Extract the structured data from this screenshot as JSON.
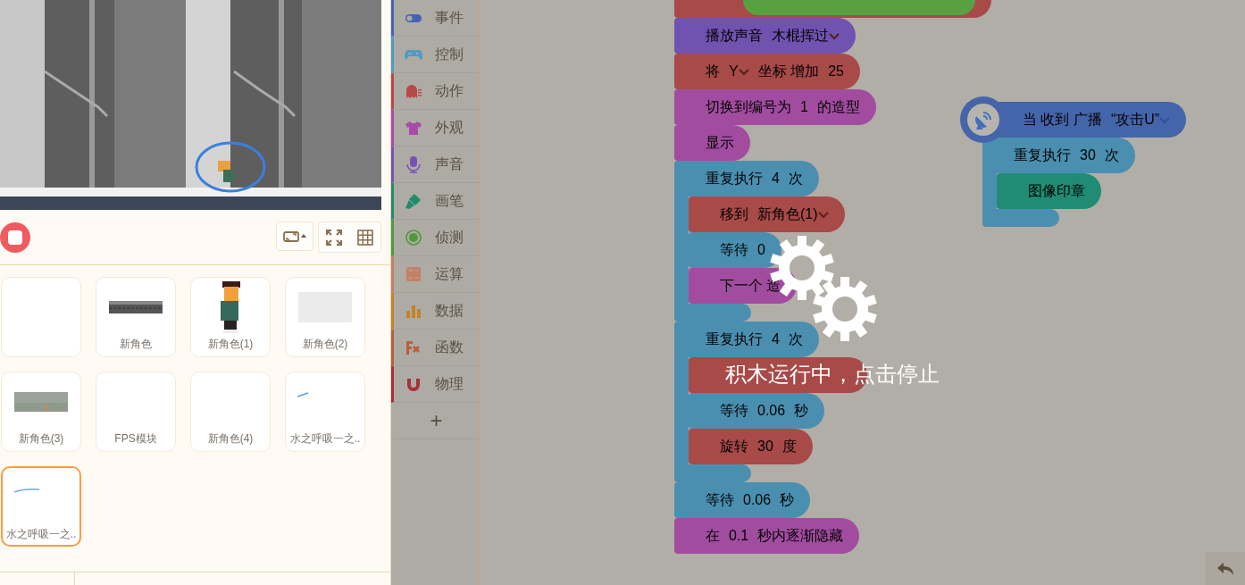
{
  "sprites": [
    {
      "kind": "empty",
      "selected": false
    },
    {
      "kind": "strip",
      "name": "新角色",
      "selected": false
    },
    {
      "kind": "figure",
      "name": "新角色(1)",
      "selected": false
    },
    {
      "kind": "faint",
      "name": "新角色(2)",
      "selected": false
    },
    {
      "kind": "scene",
      "name": "新角色(3)",
      "selected": false
    },
    {
      "kind": "empty",
      "name": "FPS模块",
      "selected": false
    },
    {
      "kind": "empty",
      "name": "新角色(4)",
      "selected": false
    },
    {
      "kind": "stroke",
      "name": "水之呼吸一之..",
      "selected": false
    },
    {
      "kind": "stroke_long",
      "name": "水之呼吸一之..",
      "selected": true
    }
  ],
  "categories": [
    {
      "label": "事件",
      "color": "#4463b4"
    },
    {
      "label": "控制",
      "color": "#4d9dc4"
    },
    {
      "label": "动作",
      "color": "#b8474a"
    },
    {
      "label": "外观",
      "color": "#a84aaa"
    },
    {
      "label": "声音",
      "color": "#7652b8"
    },
    {
      "label": "画笔",
      "color": "#1f8c6e"
    },
    {
      "label": "侦测",
      "color": "#4f9a3c"
    },
    {
      "label": "运算",
      "color": "#c48066"
    },
    {
      "label": "数据",
      "color": "#c58328"
    },
    {
      "label": "函数",
      "color": "#b8603c"
    },
    {
      "label": "物理",
      "color": "#a8303a"
    }
  ],
  "add_category": {
    "label": "+"
  },
  "scripts": [
    {
      "blocks": [
        {
          "kind": "cut",
          "color": "#a84a48"
        },
        {
          "kind": "stack",
          "color": "#7052b0",
          "parts": [
            {
              "kind": "text",
              "text": "播放声音"
            },
            {
              "kind": "drop",
              "text": "木棍挥过"
            }
          ]
        },
        {
          "kind": "stack",
          "color": "#a84a48",
          "parts": [
            {
              "kind": "text",
              "text": "将"
            },
            {
              "kind": "drop",
              "text": "Y"
            },
            {
              "kind": "text",
              "text": "坐标 增加"
            },
            {
              "kind": "num",
              "text": "25"
            }
          ]
        },
        {
          "kind": "stack",
          "color": "#a24ca0",
          "parts": [
            {
              "kind": "text",
              "text": "切换到编号为"
            },
            {
              "kind": "num",
              "text": "1"
            },
            {
              "kind": "text",
              "text": "的造型"
            }
          ]
        },
        {
          "kind": "stack",
          "color": "#a24ca0",
          "parts": [
            {
              "kind": "text",
              "text": "显示"
            }
          ]
        },
        {
          "kind": "c",
          "color": "#4a8fb0",
          "parts": [
            {
              "kind": "text",
              "text": "重复执行"
            },
            {
              "kind": "num",
              "text": "4"
            },
            {
              "kind": "text",
              "text": "次"
            }
          ],
          "children": [
            {
              "kind": "stack",
              "color": "#a84a48",
              "parts": [
                {
                  "kind": "text",
                  "text": "移到"
                },
                {
                  "kind": "drop",
                  "text": "新角色(1)"
                }
              ]
            },
            {
              "kind": "stack",
              "color": "#4a8fb0",
              "parts": [
                {
                  "kind": "text",
                  "text": "等待"
                },
                {
                  "kind": "num",
                  "text": "0"
                }
              ]
            },
            {
              "kind": "stack",
              "color": "#a24ca0",
              "parts": [
                {
                  "kind": "text",
                  "text": "下一个 造"
                }
              ]
            }
          ]
        },
        {
          "kind": "c",
          "color": "#4a8fb0",
          "parts": [
            {
              "kind": "text",
              "text": "重复执行"
            },
            {
              "kind": "num",
              "text": "4"
            },
            {
              "kind": "text",
              "text": "次"
            }
          ],
          "children": [
            {
              "kind": "stack",
              "color": "#a84a48"
            },
            {
              "kind": "stack",
              "color": "#4a8fb0",
              "parts": [
                {
                  "kind": "text",
                  "text": "等待"
                },
                {
                  "kind": "num",
                  "text": "0.06"
                },
                {
                  "kind": "text",
                  "text": "秒"
                }
              ]
            },
            {
              "kind": "stack",
              "color": "#a84a48",
              "parts": [
                {
                  "kind": "text",
                  "text": "旋转"
                },
                {
                  "kind": "num",
                  "text": "30"
                },
                {
                  "kind": "text",
                  "text": "度"
                }
              ]
            }
          ]
        },
        {
          "kind": "stack",
          "color": "#4a8fb0",
          "parts": [
            {
              "kind": "text",
              "text": "等待"
            },
            {
              "kind": "num",
              "text": "0.06"
            },
            {
              "kind": "text",
              "text": "秒"
            }
          ]
        },
        {
          "kind": "stack",
          "color": "#a24ca0",
          "parts": [
            {
              "kind": "text",
              "text": "在"
            },
            {
              "kind": "num",
              "text": "0.1"
            },
            {
              "kind": "text",
              "text": "秒内逐渐隐藏"
            }
          ]
        }
      ]
    },
    {
      "blocks": [
        {
          "kind": "hat",
          "color": "#4565aa",
          "parts": [
            {
              "kind": "text",
              "text": "当 收到 广播"
            },
            {
              "kind": "broadcast",
              "text": "“攻击U”"
            }
          ]
        },
        {
          "kind": "c",
          "color": "#4a8fb0",
          "parts": [
            {
              "kind": "text",
              "text": "重复执行"
            },
            {
              "kind": "num",
              "text": "30"
            },
            {
              "kind": "text",
              "text": "次"
            }
          ],
          "children": [
            {
              "kind": "stack",
              "color": "#1f8c73",
              "parts": [
                {
                  "kind": "text",
                  "text": "图像印章"
                }
              ]
            }
          ]
        }
      ]
    }
  ],
  "overlay": {
    "message": "积木运行中，点击停止"
  }
}
